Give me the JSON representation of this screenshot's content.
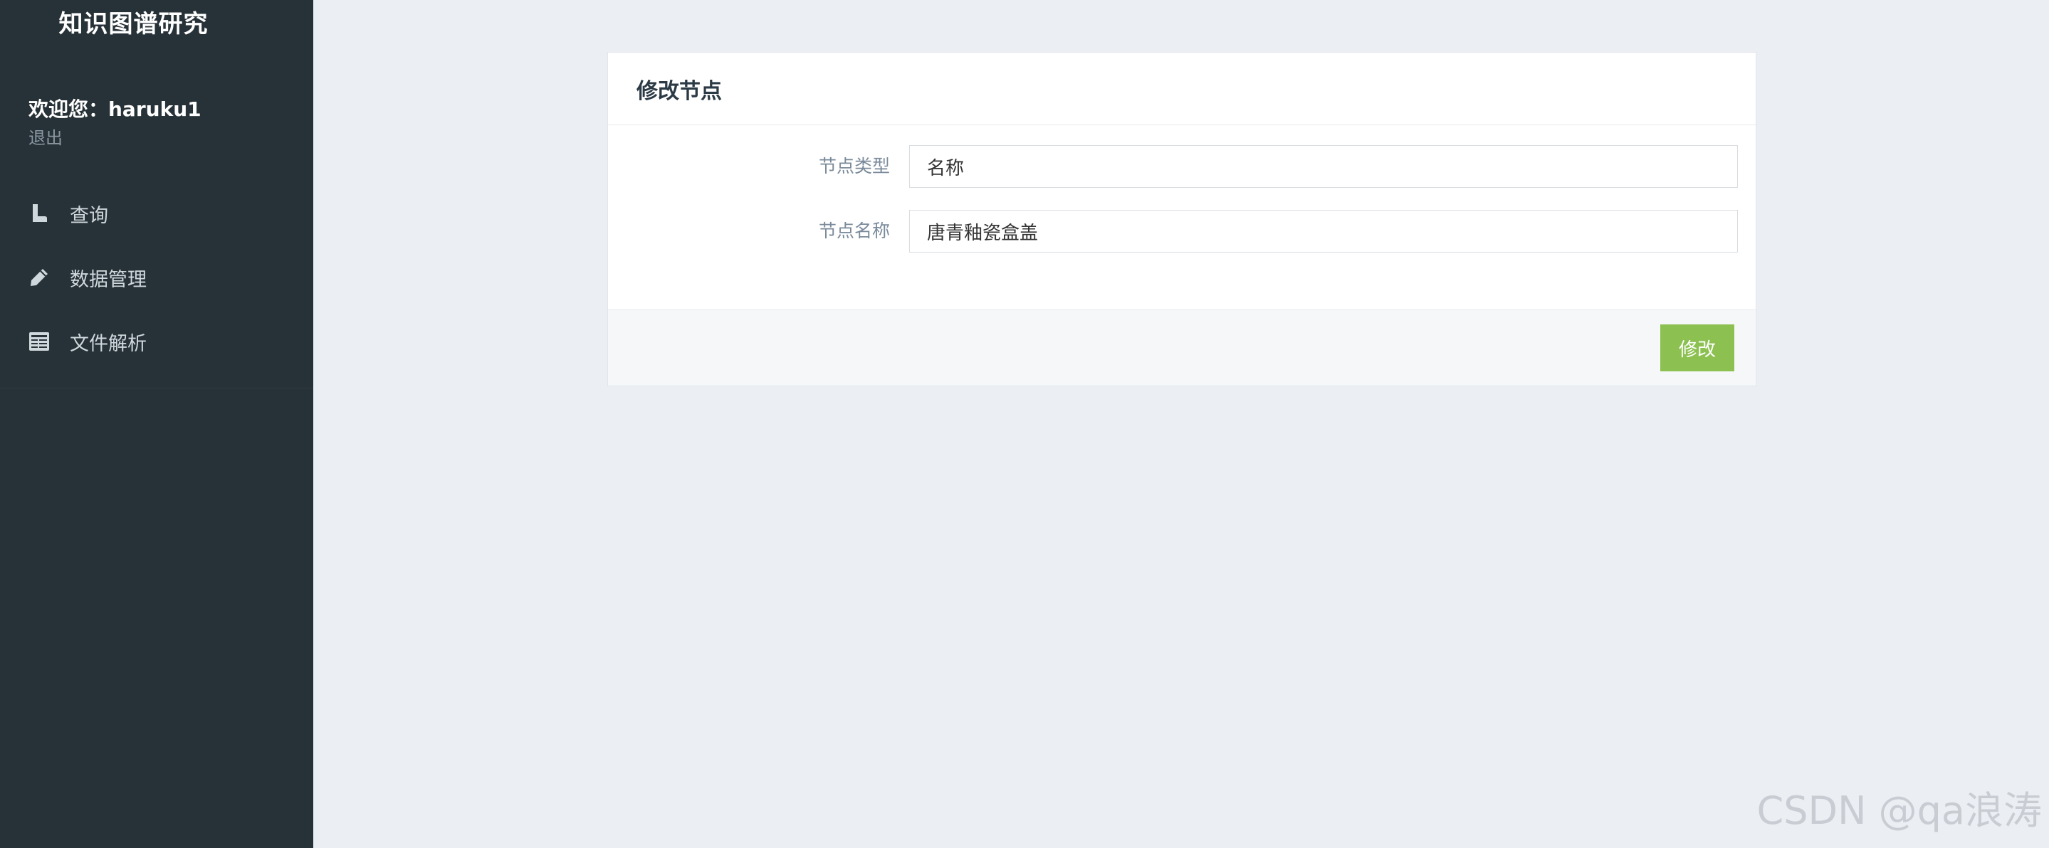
{
  "sidebar": {
    "brand": "知识图谱研究",
    "welcome": "欢迎您：haruku1",
    "logout": "退出",
    "items": [
      {
        "label": "查询",
        "icon": "boot-icon"
      },
      {
        "label": "数据管理",
        "icon": "pencil-icon"
      },
      {
        "label": "文件解析",
        "icon": "document-list-icon"
      }
    ]
  },
  "card": {
    "title": "修改节点",
    "fields": [
      {
        "label": "节点类型",
        "value": "名称"
      },
      {
        "label": "节点名称",
        "value": "唐青釉瓷盒盖"
      }
    ],
    "submit_label": "修改"
  },
  "watermark": "CSDN @qa浪涛",
  "colors": {
    "sidebar_bg": "#273238",
    "page_bg": "#ebeef3",
    "primary_button": "#8cc152"
  }
}
